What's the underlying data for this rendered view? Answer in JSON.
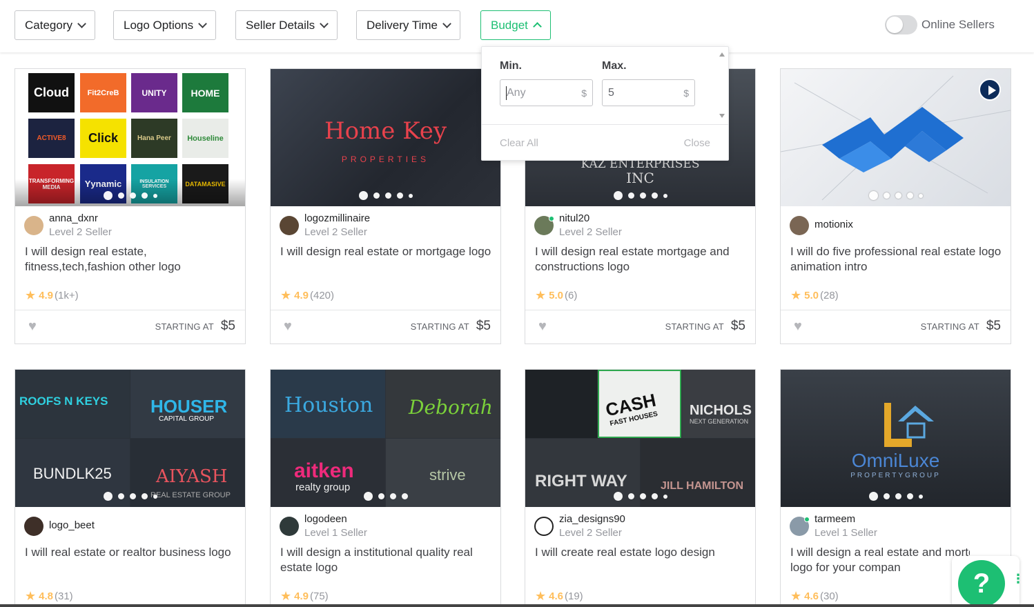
{
  "filters": {
    "category": "Category",
    "logo_options": "Logo Options",
    "seller_details": "Seller Details",
    "delivery_time": "Delivery Time",
    "budget": "Budget",
    "online_sellers": "Online Sellers"
  },
  "budget_dropdown": {
    "min_label": "Min.",
    "max_label": "Max.",
    "min_placeholder": "Any",
    "max_value": "5",
    "currency": "$",
    "clear_all": "Clear All",
    "close": "Close"
  },
  "gigs": [
    {
      "seller": "anna_dxnr",
      "level": "Level 2 Seller",
      "title": "I will design real estate, fitness,tech,fashion other logo",
      "rating": "4.9",
      "count": "(1k+)",
      "starting": "STARTING AT",
      "price": "$5"
    },
    {
      "seller": "logozmillinaire",
      "level": "Level 2 Seller",
      "title": "I will design real estate or mortgage logo",
      "rating": "4.9",
      "count": "(420)",
      "starting": "STARTING AT",
      "price": "$5"
    },
    {
      "seller": "nitul20",
      "level": "Level 2 Seller",
      "title": "I will design real estate mortgage and constructions logo",
      "rating": "5.0",
      "count": "(6)",
      "starting": "STARTING AT",
      "price": "$5"
    },
    {
      "seller": "motionix",
      "level": "",
      "title": "I will do five professional real estate logo animation intro",
      "rating": "5.0",
      "count": "(28)",
      "starting": "STARTING AT",
      "price": "$5"
    },
    {
      "seller": "logo_beet",
      "level": "",
      "title": "I will real estate or realtor business logo",
      "rating": "4.8",
      "count": "(31)"
    },
    {
      "seller": "logodeen",
      "level": "Level 1 Seller",
      "title": "I will design a institutional quality real estate logo",
      "rating": "4.9",
      "count": "(75)"
    },
    {
      "seller": "zia_designs90",
      "level": "Level 2 Seller",
      "title": "I will create real estate logo design",
      "rating": "4.6",
      "count": "(19)"
    },
    {
      "seller": "tarmeem",
      "level": "Level 1 Seller",
      "title": "I will design a real estate and mortgage logo for your compan",
      "rating": "4.6",
      "count": "(30)"
    }
  ],
  "thumb_text": {
    "g1": [
      "Cloud",
      "Fit2CreB",
      "UNITY",
      "HOME",
      "ACTIVE8",
      "Click",
      "Hana Peer",
      "Houseline",
      "TRANSFORMING MEDIA",
      "Yynamic",
      "INSULATION SERVICES",
      "DATAMASIVE"
    ],
    "g2": [
      "Home Key",
      "PROPERTIES"
    ],
    "g3": [
      "KAZ ENTERPRISES",
      "INC"
    ],
    "g5": [
      "ROOFS N KEYS",
      "HOUSER",
      "CAPITAL GROUP",
      "BUNDLK25",
      "AIYASH",
      "REAL ESTATE GROUP"
    ],
    "g6": [
      "Houston",
      "Deborah",
      "aitken",
      "realty group",
      "strive"
    ],
    "g7": [
      "CASH",
      "FAST HOUSES",
      "NICHOLS",
      "NEXT GENERATION",
      "RIGHT WAY",
      "JILL HAMILTON"
    ],
    "g8": [
      "OmniLuxe",
      "PROPERTYGROUP"
    ]
  },
  "help": {
    "label": "?"
  },
  "colors": {
    "brand_green": "#1dbf73",
    "star": "#ffbe5b"
  }
}
